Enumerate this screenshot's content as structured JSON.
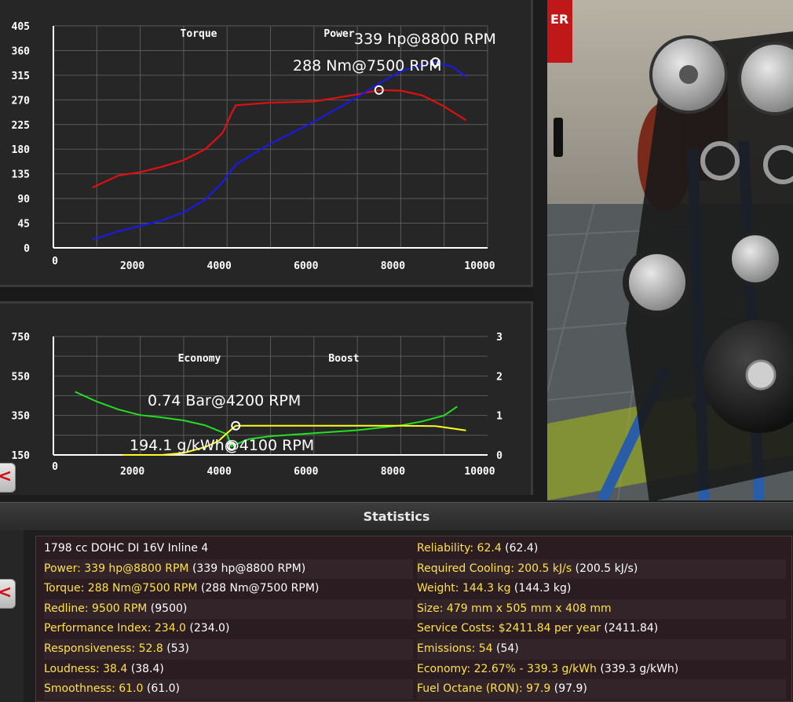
{
  "chart_data": [
    {
      "type": "line",
      "x_ticks": [
        "0",
        "2000",
        "4000",
        "6000",
        "8000",
        "10000"
      ],
      "y_ticks": [
        "405",
        "360",
        "315",
        "270",
        "225",
        "180",
        "135",
        "90",
        "45",
        "0"
      ],
      "xlim": [
        0,
        10000
      ],
      "ylim": [
        0,
        405
      ],
      "grid": true,
      "legend_position": "top",
      "series": [
        {
          "name": "Torque",
          "color": "#e01010",
          "points": [
            [
              900,
              110
            ],
            [
              1500,
              132
            ],
            [
              2000,
              138
            ],
            [
              2500,
              148
            ],
            [
              3000,
              160
            ],
            [
              3500,
              180
            ],
            [
              3900,
              210
            ],
            [
              4100,
              245
            ],
            [
              4200,
              260
            ],
            [
              5000,
              265
            ],
            [
              6000,
              267
            ],
            [
              7000,
              280
            ],
            [
              7500,
              288
            ],
            [
              8000,
              287
            ],
            [
              8500,
              278
            ],
            [
              9000,
              258
            ],
            [
              9500,
              233
            ]
          ]
        },
        {
          "name": "Power",
          "color": "#1a1ae6",
          "points": [
            [
              900,
              15
            ],
            [
              1500,
              30
            ],
            [
              2000,
              40
            ],
            [
              2500,
              50
            ],
            [
              3000,
              65
            ],
            [
              3500,
              88
            ],
            [
              3900,
              120
            ],
            [
              4200,
              152
            ],
            [
              5000,
              190
            ],
            [
              6000,
              230
            ],
            [
              7000,
              275
            ],
            [
              7500,
              300
            ],
            [
              8000,
              322
            ],
            [
              8500,
              334
            ],
            [
              8800,
              339
            ],
            [
              9200,
              330
            ],
            [
              9500,
              312
            ]
          ]
        }
      ],
      "annotations": {
        "power_peak": "339 hp@8800 RPM",
        "torque_peak": "288 Nm@7500 RPM",
        "power_peak_point": [
          8800,
          339
        ],
        "torque_peak_point": [
          7500,
          288
        ]
      }
    },
    {
      "type": "line",
      "x_ticks": [
        "0",
        "2000",
        "4000",
        "6000",
        "8000",
        "10000"
      ],
      "y_left_ticks": [
        "750",
        "550",
        "350",
        "150"
      ],
      "y_right_ticks": [
        "3",
        "2",
        "1",
        "0"
      ],
      "xlim": [
        0,
        10000
      ],
      "ylim_left": [
        150,
        750
      ],
      "ylim_right": [
        0,
        3
      ],
      "grid": true,
      "legend_position": "top",
      "series": [
        {
          "name": "Economy",
          "color": "#22e022",
          "axis": "left",
          "points": [
            [
              500,
              470
            ],
            [
              1000,
              420
            ],
            [
              1500,
              380
            ],
            [
              2000,
              352
            ],
            [
              2500,
              340
            ],
            [
              3000,
              325
            ],
            [
              3500,
              300
            ],
            [
              4000,
              255
            ],
            [
              4100,
              194
            ],
            [
              4500,
              230
            ],
            [
              5000,
              245
            ],
            [
              6000,
              260
            ],
            [
              7000,
              275
            ],
            [
              8000,
              300
            ],
            [
              8500,
              320
            ],
            [
              9000,
              350
            ],
            [
              9300,
              395
            ]
          ]
        },
        {
          "name": "Boost",
          "color": "#ffff20",
          "axis": "right",
          "points": [
            [
              1600,
              0
            ],
            [
              2500,
              0
            ],
            [
              3000,
              0.05
            ],
            [
              3500,
              0.2
            ],
            [
              3800,
              0.35
            ],
            [
              4000,
              0.55
            ],
            [
              4200,
              0.74
            ],
            [
              5000,
              0.74
            ],
            [
              6000,
              0.74
            ],
            [
              7000,
              0.74
            ],
            [
              8000,
              0.74
            ],
            [
              8800,
              0.73
            ],
            [
              9000,
              0.7
            ],
            [
              9500,
              0.62
            ]
          ]
        }
      ],
      "annotations": {
        "boost_peak": "0.74 Bar@4200 RPM",
        "economy_best": "194.1 g/kWh@4100 RPM",
        "boost_peak_point": [
          4200,
          0.74
        ],
        "economy_best_point": [
          4100,
          194.1
        ]
      }
    }
  ],
  "stats": {
    "title": "Statistics",
    "left": [
      {
        "label": "1798 cc DOHC DI 16V Inline 4",
        "value": "",
        "label_white": true
      },
      {
        "label": "Power: 339 hp@8800 RPM",
        "value": " (339 hp@8800 RPM)"
      },
      {
        "label": "Torque: 288 Nm@7500 RPM",
        "value": " (288 Nm@7500 RPM)"
      },
      {
        "label": "Redline: 9500 RPM",
        "value": " (9500)"
      },
      {
        "label": "Performance Index: 234.0",
        "value": " (234.0)"
      },
      {
        "label": "Responsiveness: 52.8",
        "value": " (53)"
      },
      {
        "label": "Loudness: 38.4",
        "value": " (38.4)"
      },
      {
        "label": "Smoothness: 61.0",
        "value": " (61.0)"
      }
    ],
    "right": [
      {
        "label": "Reliability: 62.4",
        "value": " (62.4)"
      },
      {
        "label": "Required Cooling: 200.5 kJ/s",
        "value": " (200.5 kJ/s)"
      },
      {
        "label": "Weight: 144.3 kg",
        "value": " (144.3 kg)"
      },
      {
        "label": "Size: 479 mm x 505 mm x 408 mm",
        "value": ""
      },
      {
        "label": "Service Costs: $2411.84 per year",
        "value": " (2411.84)"
      },
      {
        "label": "Emissions: 54",
        "value": " (54)"
      },
      {
        "label": "Economy: 22.67% - 339.3 g/kWh",
        "value": " (339.3 g/kWh)"
      },
      {
        "label": "Fuel Octane (RON): 97.9",
        "value": " (97.9)"
      }
    ]
  },
  "nav": {
    "left_arrow_glyph": "<"
  },
  "scene": {
    "sign_text": "ER"
  },
  "colors": {
    "torque": "#e01010",
    "power": "#1a1ae6",
    "economy": "#22e022",
    "boost": "#ffff20",
    "stat_label": "#ffe14a"
  }
}
